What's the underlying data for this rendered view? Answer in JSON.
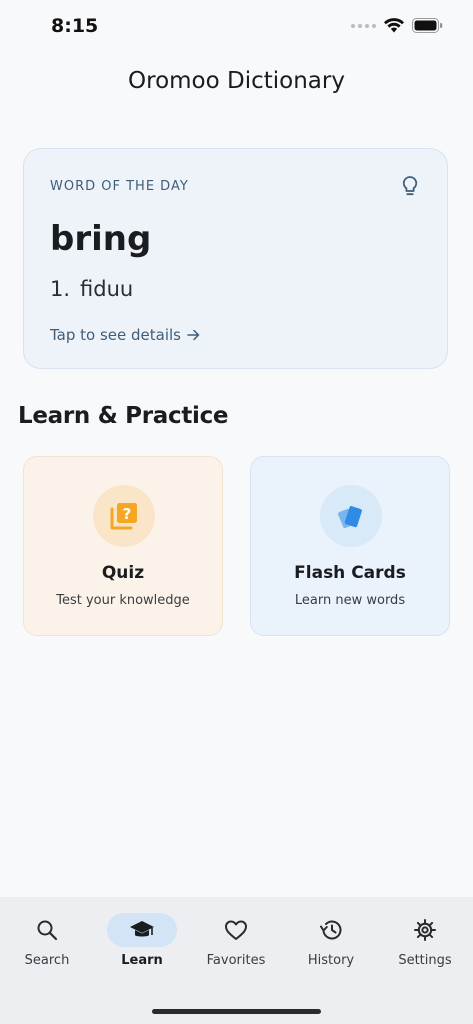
{
  "status_bar": {
    "time": "8:15"
  },
  "app": {
    "title": "Oromoo Dictionary"
  },
  "word_of_the_day": {
    "label": "WORD OF THE DAY",
    "word": "bring",
    "definition_number": "1.",
    "definition": "fiduu",
    "link_text": "Tap to see details",
    "icon": "lightbulb-icon"
  },
  "learn_section": {
    "title": "Learn & Practice",
    "cards": [
      {
        "title": "Quiz",
        "subtitle": "Test your knowledge",
        "icon": "quiz-icon",
        "accent": "#f5a623"
      },
      {
        "title": "Flash Cards",
        "subtitle": "Learn new words",
        "icon": "flash-cards-icon",
        "accent": "#2f8be6"
      }
    ]
  },
  "bottom_nav": {
    "items": [
      {
        "label": "Search",
        "icon": "search-icon",
        "active": false
      },
      {
        "label": "Learn",
        "icon": "graduation-cap-icon",
        "active": true
      },
      {
        "label": "Favorites",
        "icon": "heart-icon",
        "active": false
      },
      {
        "label": "History",
        "icon": "history-icon",
        "active": false
      },
      {
        "label": "Settings",
        "icon": "gear-icon",
        "active": false
      }
    ]
  },
  "colors": {
    "background": "#f8f9fb",
    "card_blue": "#eef3fa",
    "accent_text": "#3f5e78",
    "nav_active_pill": "#d3e4f6"
  }
}
